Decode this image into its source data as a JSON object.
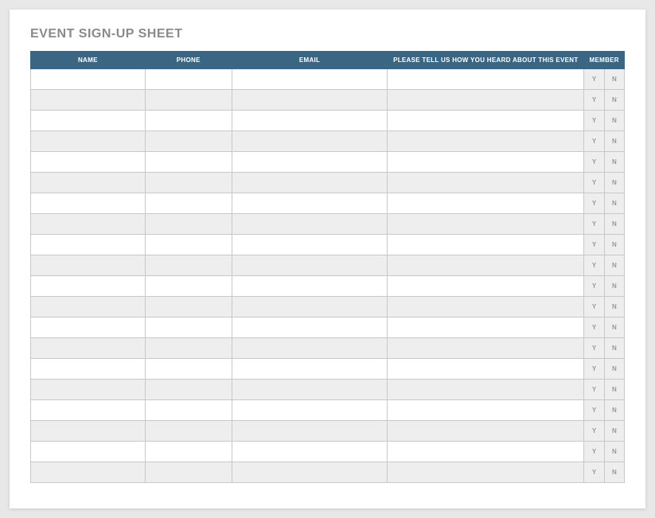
{
  "title": "EVENT SIGN-UP SHEET",
  "columns": {
    "name": "NAME",
    "phone": "PHONE",
    "email": "EMAIL",
    "heard": "PLEASE TELL US HOW YOU HEARD ABOUT THIS EVENT",
    "member": "MEMBER"
  },
  "yn": {
    "y": "Y",
    "n": "N"
  },
  "row_count": 20,
  "colors": {
    "header_bg": "#3a6683",
    "header_fg": "#ffffff",
    "alt_row": "#eeeeee",
    "border": "#c8c8c8",
    "title_color": "#8a8a8a"
  }
}
